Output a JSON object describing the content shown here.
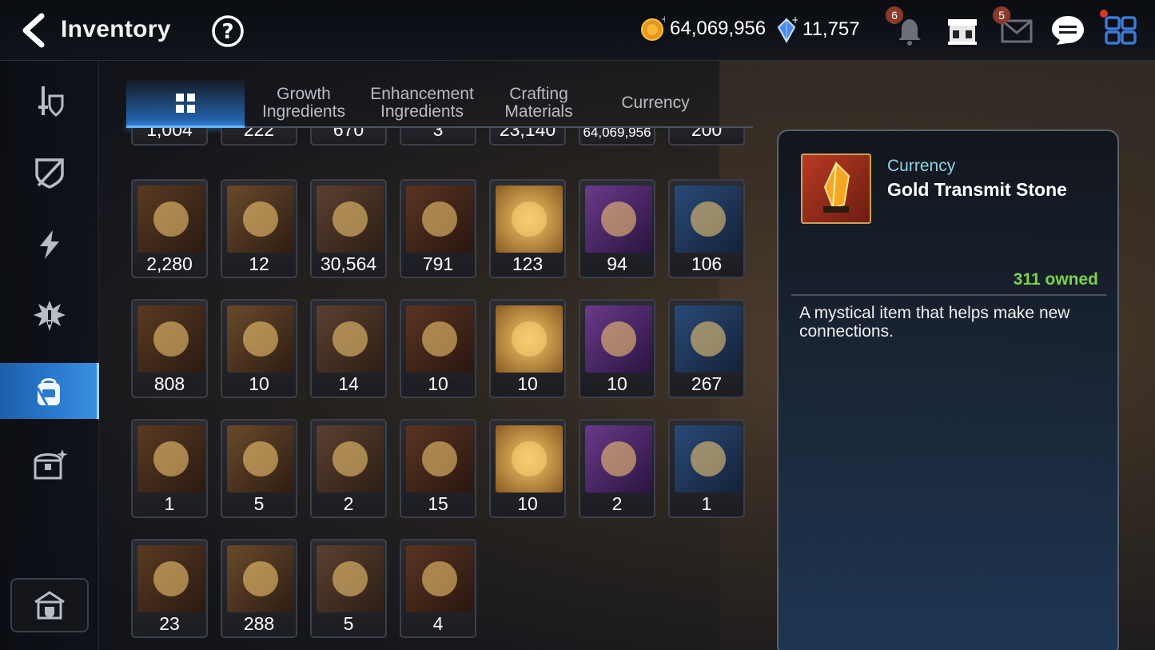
{
  "header": {
    "title": "Inventory",
    "gold": "64,069,956",
    "gems": "11,757",
    "notifications_badge": "6",
    "mail_badge": "5"
  },
  "tabs": [
    {
      "label": "",
      "icon": "grid-icon",
      "active": true
    },
    {
      "label": "Growth\nIngredients"
    },
    {
      "label": "Enhancement\nIngredients"
    },
    {
      "label": "Crafting\nMaterials"
    },
    {
      "label": "Currency"
    }
  ],
  "sidebar": {
    "items": [
      "equipment-icon",
      "artifact-icon",
      "skill-lightning-icon",
      "catalyst-icon",
      "backpack-icon",
      "chest-icon"
    ],
    "active_index": 4,
    "bottom": "storage-house-icon"
  },
  "grid": {
    "rows": [
      [
        "1,004",
        "222",
        "670",
        "3",
        "23,140",
        "64,069,956",
        "200"
      ],
      [
        "2,280",
        "12",
        "30,564",
        "791",
        "123",
        "94",
        "106"
      ],
      [
        "808",
        "10",
        "14",
        "10",
        "10",
        "10",
        "267"
      ],
      [
        "1",
        "5",
        "2",
        "15",
        "10",
        "2",
        "1"
      ],
      [
        "23",
        "288",
        "5",
        "4"
      ]
    ]
  },
  "detail": {
    "category": "Currency",
    "name": "Gold Transmit Stone",
    "owned": "311 owned",
    "description": "A mystical item that helps make new connections."
  },
  "colors": {
    "accent_blue": "#2a7bd0",
    "owned_green": "#7cd24a",
    "category_cyan": "#8fd4e8"
  }
}
